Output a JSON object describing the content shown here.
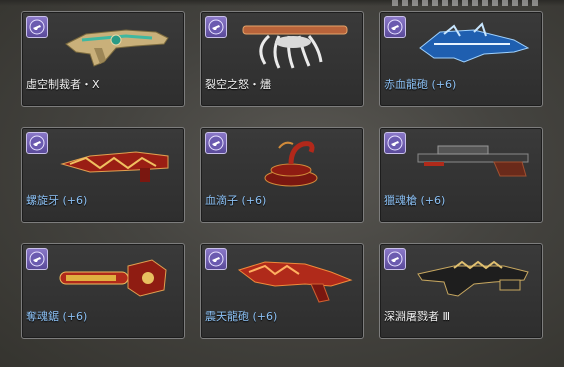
{
  "inventory": {
    "items": [
      {
        "name": "虛空制裁者・X",
        "color": "#f2f2f2",
        "icon": "void-sanction-rifle-icon"
      },
      {
        "name": "裂空之怒・燼",
        "color": "#f2f2f2",
        "icon": "skyrend-fury-launcher-icon"
      },
      {
        "name": "赤血龍砲 (+6)",
        "color": "#8cc1f5",
        "icon": "crimson-dragon-cannon-icon"
      },
      {
        "name": "螺旋牙 (+6)",
        "color": "#8cc1f5",
        "icon": "spiral-fang-drill-icon"
      },
      {
        "name": "血滴子 (+6)",
        "color": "#8cc1f5",
        "icon": "blood-drop-scorpion-icon"
      },
      {
        "name": "獵魂槍 (+6)",
        "color": "#8cc1f5",
        "icon": "soul-hunter-rifle-icon"
      },
      {
        "name": "奪魂鋸 (+6)",
        "color": "#8cc1f5",
        "icon": "soul-reaper-chainsaw-icon"
      },
      {
        "name": "震天龍砲 (+6)",
        "color": "#8cc1f5",
        "icon": "thunder-dragon-cannon-icon"
      },
      {
        "name": "深淵屠戮者 Ⅲ",
        "color": "#f2f2f2",
        "icon": "abyss-slayer-rifle-icon"
      }
    ]
  }
}
